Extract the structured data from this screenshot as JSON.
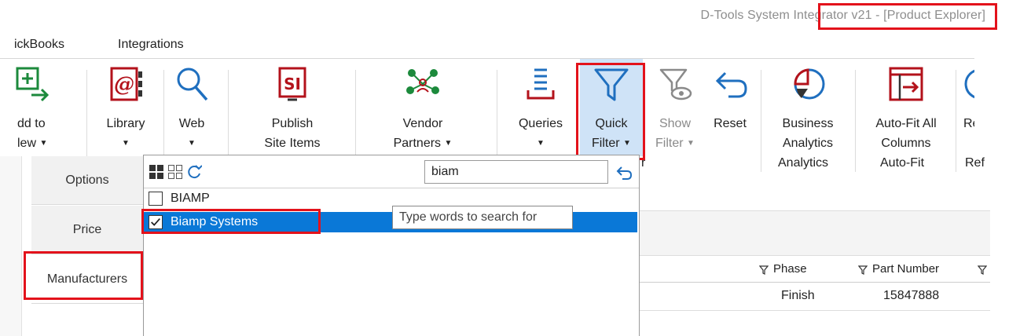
{
  "window_title": "D-Tools System Integrator v21 - [Product Explorer]",
  "menubar": {
    "items": [
      "ickBooks",
      "Integrations"
    ]
  },
  "ribbon": {
    "buttons": [
      {
        "label1": "dd to",
        "label2": "lew",
        "icon": "add-to-new-icon"
      },
      {
        "label1": "Library",
        "label2": "",
        "icon": "library-icon"
      },
      {
        "label1": "Web",
        "label2": "",
        "icon": "search-web-icon"
      },
      {
        "label1": "Publish",
        "label2": "Site Items",
        "icon": "publish-si-icon"
      },
      {
        "label1": "Vendor",
        "label2": "Partners",
        "icon": "vendor-partners-icon"
      },
      {
        "label1": "Queries",
        "label2": "",
        "icon": "queries-icon"
      },
      {
        "label1": "Quick",
        "label2": "Filter",
        "icon": "funnel-icon"
      },
      {
        "label1": "Show",
        "label2": "Filter",
        "icon": "show-filter-icon"
      },
      {
        "label1": "Reset",
        "label2": "",
        "icon": "undo-icon"
      },
      {
        "label1": "Business",
        "label2": "Analytics",
        "icon": "pie-chart-icon"
      },
      {
        "label1": "Auto-Fit All",
        "label2": "Columns",
        "icon": "auto-fit-icon"
      },
      {
        "label1": "Ref",
        "label2": "",
        "icon": "refresh-icon"
      }
    ],
    "caret": "▼",
    "groups": {
      "analytics": "Analytics",
      "autofit": "Auto-Fit",
      "ref": "Ref"
    },
    "stray_r": "r"
  },
  "side_tabs": [
    "Options",
    "Price",
    "Manufacturers"
  ],
  "dropdown": {
    "search_value": "biam",
    "rows": [
      {
        "label": "BIAMP",
        "checked": false
      },
      {
        "label": "Biamp Systems",
        "checked": true
      }
    ],
    "tooltip": "Type words to search for"
  },
  "grid": {
    "columns": [
      "Phase",
      "Part Number"
    ],
    "row": {
      "phase": "Finish",
      "part_number": "15847888"
    }
  },
  "colors": {
    "highlight": "#e3121b",
    "selection": "#0a78d7",
    "active_button": "#cfe3f7",
    "green_icon": "#1c8a3c",
    "red_icon": "#b3121b",
    "blue_icon": "#1f6fbf"
  }
}
